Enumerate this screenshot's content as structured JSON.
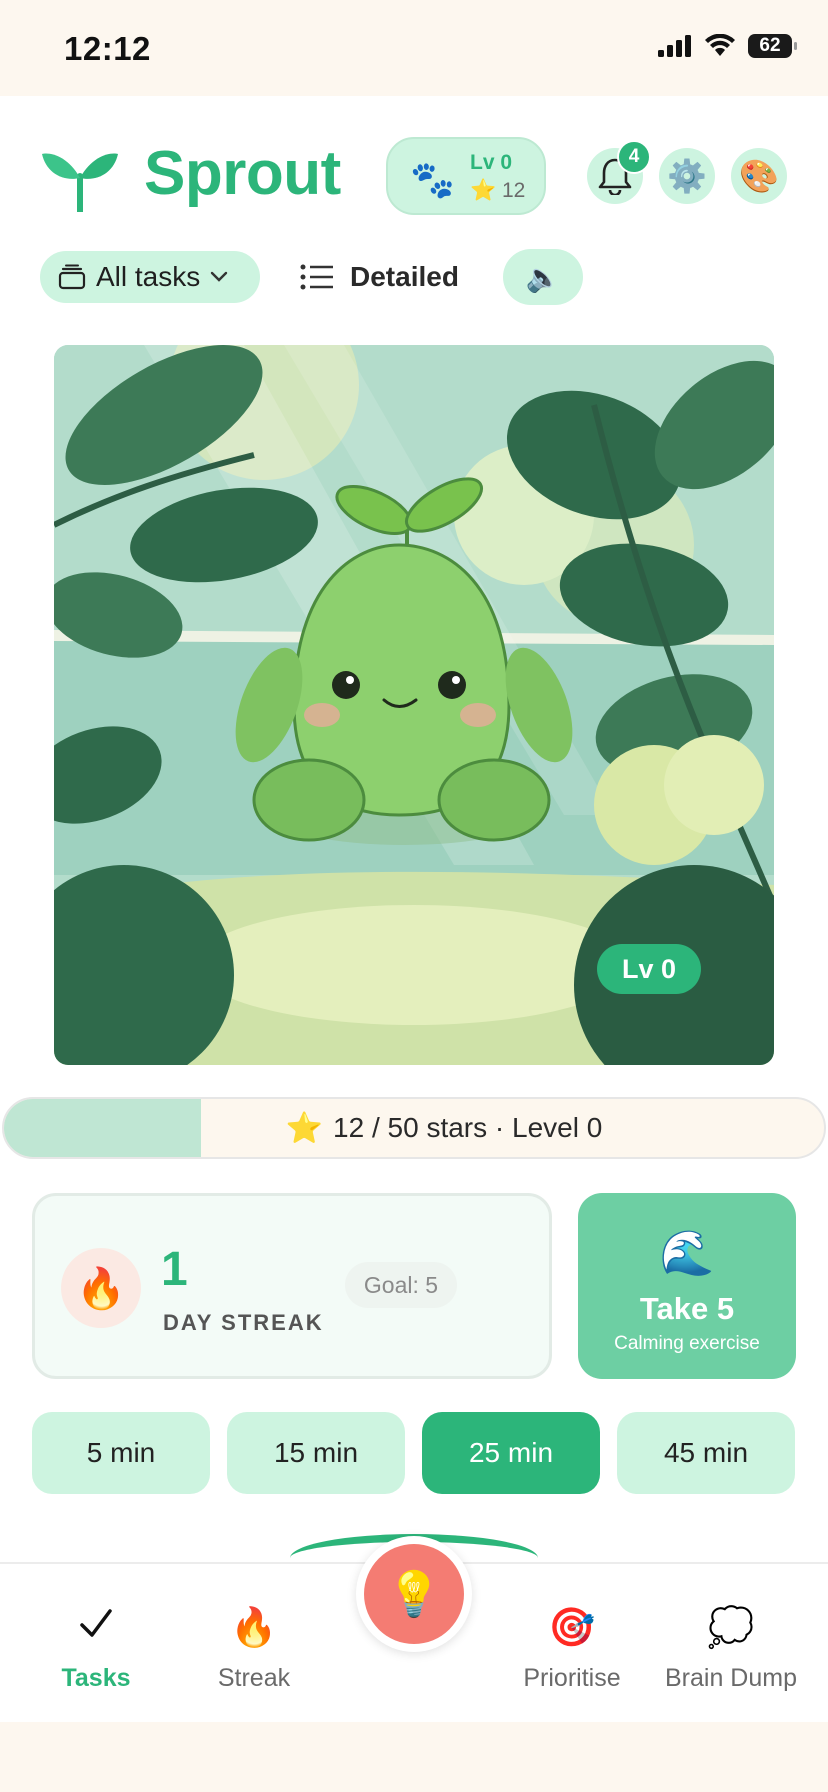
{
  "status": {
    "time": "12:12",
    "battery": "62"
  },
  "header": {
    "title": "Sprout",
    "level_pill": {
      "level": "Lv 0",
      "stars": "12"
    },
    "notifications_count": "4"
  },
  "filters": {
    "category": "All tasks",
    "view": "Detailed"
  },
  "hero": {
    "level_badge": "Lv 0"
  },
  "progress": {
    "text": "12 / 50 stars · Level 0",
    "fraction": 0.24
  },
  "streak": {
    "count": "1",
    "label": "DAY STREAK",
    "goal": "Goal: 5"
  },
  "take5": {
    "title": "Take 5",
    "subtitle": "Calming exercise"
  },
  "timers": [
    {
      "label": "5 min",
      "active": false
    },
    {
      "label": "15 min",
      "active": false
    },
    {
      "label": "25 min",
      "active": true
    },
    {
      "label": "45 min",
      "active": false
    }
  ],
  "nav": [
    {
      "label": "Tasks",
      "icon": "check-icon",
      "active": true
    },
    {
      "label": "Streak",
      "icon": "fire-icon",
      "active": false
    },
    {
      "label": "Prioritise",
      "icon": "target-icon",
      "active": false
    },
    {
      "label": "Brain Dump",
      "icon": "thought-cloud-icon",
      "active": false
    }
  ],
  "colors": {
    "accent": "#2cb57a",
    "accent_light": "#cdf4e0",
    "fab": "#f47c73"
  }
}
